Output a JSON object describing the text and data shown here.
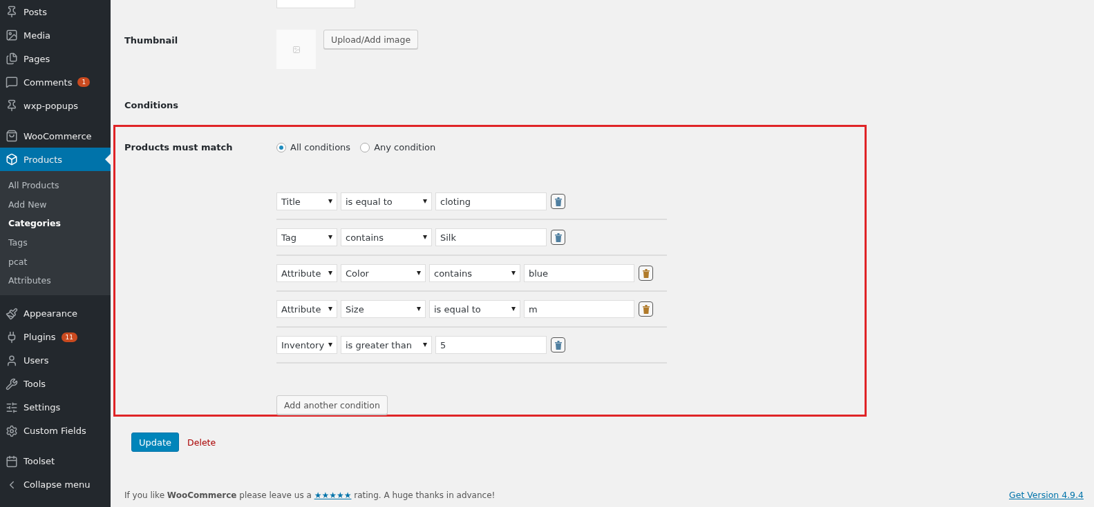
{
  "sidebar": {
    "groups": [
      [
        {
          "label": "Posts",
          "selected": false
        },
        {
          "label": "Media",
          "selected": false
        },
        {
          "label": "Pages",
          "selected": false
        },
        {
          "label": "Comments",
          "badge": "1",
          "selected": false
        },
        {
          "label": "wxp-popups",
          "selected": false
        }
      ],
      [
        {
          "label": "WooCommerce",
          "selected": false
        },
        {
          "label": "Products",
          "selected": true,
          "children": [
            {
              "label": "All Products",
              "selected": false
            },
            {
              "label": "Add New",
              "selected": false
            },
            {
              "label": "Categories",
              "selected": true
            },
            {
              "label": "Tags",
              "selected": false
            },
            {
              "label": "pcat",
              "selected": false
            },
            {
              "label": "Attributes",
              "selected": false
            }
          ]
        }
      ],
      [
        {
          "label": "Appearance",
          "selected": false
        },
        {
          "label": "Plugins",
          "badge": "11",
          "selected": false
        },
        {
          "label": "Users",
          "selected": false
        },
        {
          "label": "Tools",
          "selected": false
        },
        {
          "label": "Settings",
          "selected": false
        },
        {
          "label": "Custom Fields",
          "selected": false
        }
      ],
      [
        {
          "label": "Toolset",
          "selected": false
        },
        {
          "label": "Collapse menu",
          "selected": false
        }
      ]
    ]
  },
  "thumbnail": {
    "label": "Thumbnail",
    "button": "Upload/Add image"
  },
  "conditions_heading": "Conditions",
  "match": {
    "label": "Products must match",
    "options": [
      {
        "label": "All conditions",
        "selected": true
      },
      {
        "label": "Any condition",
        "selected": false
      }
    ]
  },
  "conditions": [
    {
      "kind": "basic",
      "fields": [
        "Title",
        "is equal to"
      ],
      "value": "cloting",
      "color": "#4f7fa0"
    },
    {
      "kind": "basic",
      "fields": [
        "Tag",
        "contains"
      ],
      "value": "Silk",
      "color": "#4f7fa0"
    },
    {
      "kind": "attribute",
      "fields": [
        "Attribute",
        "Color",
        "contains"
      ],
      "value": "blue",
      "color": "#b07a2a"
    },
    {
      "kind": "attribute",
      "fields": [
        "Attribute",
        "Size",
        "is equal to"
      ],
      "value": "m",
      "color": "#b07a2a"
    },
    {
      "kind": "basic",
      "fields": [
        "Inventory",
        "is greater than"
      ],
      "value": "5",
      "color": "#4f7fa0"
    }
  ],
  "add_button": "Add another condition",
  "actions": {
    "update": "Update",
    "delete": "Delete"
  },
  "footer": {
    "before": "If you like **WooCommerce** please leave us a ",
    "link": "★★★★★",
    "after": " rating. A huge thanks in advance!",
    "version": "Get Version 4.9.4"
  }
}
